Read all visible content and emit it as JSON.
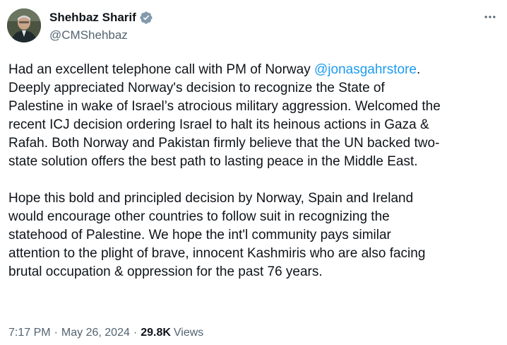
{
  "author": {
    "display_name": "Shehbaz Sharif",
    "handle": "@CMShehbaz",
    "verified_badge": "verified-badge-icon",
    "badge_color": "#829aab"
  },
  "tweet": {
    "paragraphs": [
      {
        "before": "Had an excellent telephone call with PM of Norway ",
        "mention": "@jonasgahrstore",
        "after": ".\nDeeply appreciated Norway's decision to recognize the State of\nPalestine in wake of Israel’s atrocious military aggression. Welcomed the\nrecent ICJ decision ordering Israel to halt its heinous actions in Gaza &\nRafah. Both Norway and Pakistan firmly believe that the UN backed two-\nstate solution offers the best path to lasting peace in the Middle East."
      },
      {
        "text": "Hope this bold and principled decision by Norway, Spain and Ireland\nwould encourage other countries to follow suit in recognizing the\nstatehood of Palestine. We hope the int'l community pays similar\nattention to the plight of brave, innocent Kashmiris who are also facing\nbrutal occupation & oppression for the past 76 years."
      }
    ],
    "mention_color": "#1d9bf0"
  },
  "meta": {
    "time": "7:17 PM",
    "separator": "·",
    "date": "May 26, 2024",
    "views_count": "29.8K",
    "views_label": "Views"
  },
  "icons": {
    "more": "more-options-icon"
  }
}
